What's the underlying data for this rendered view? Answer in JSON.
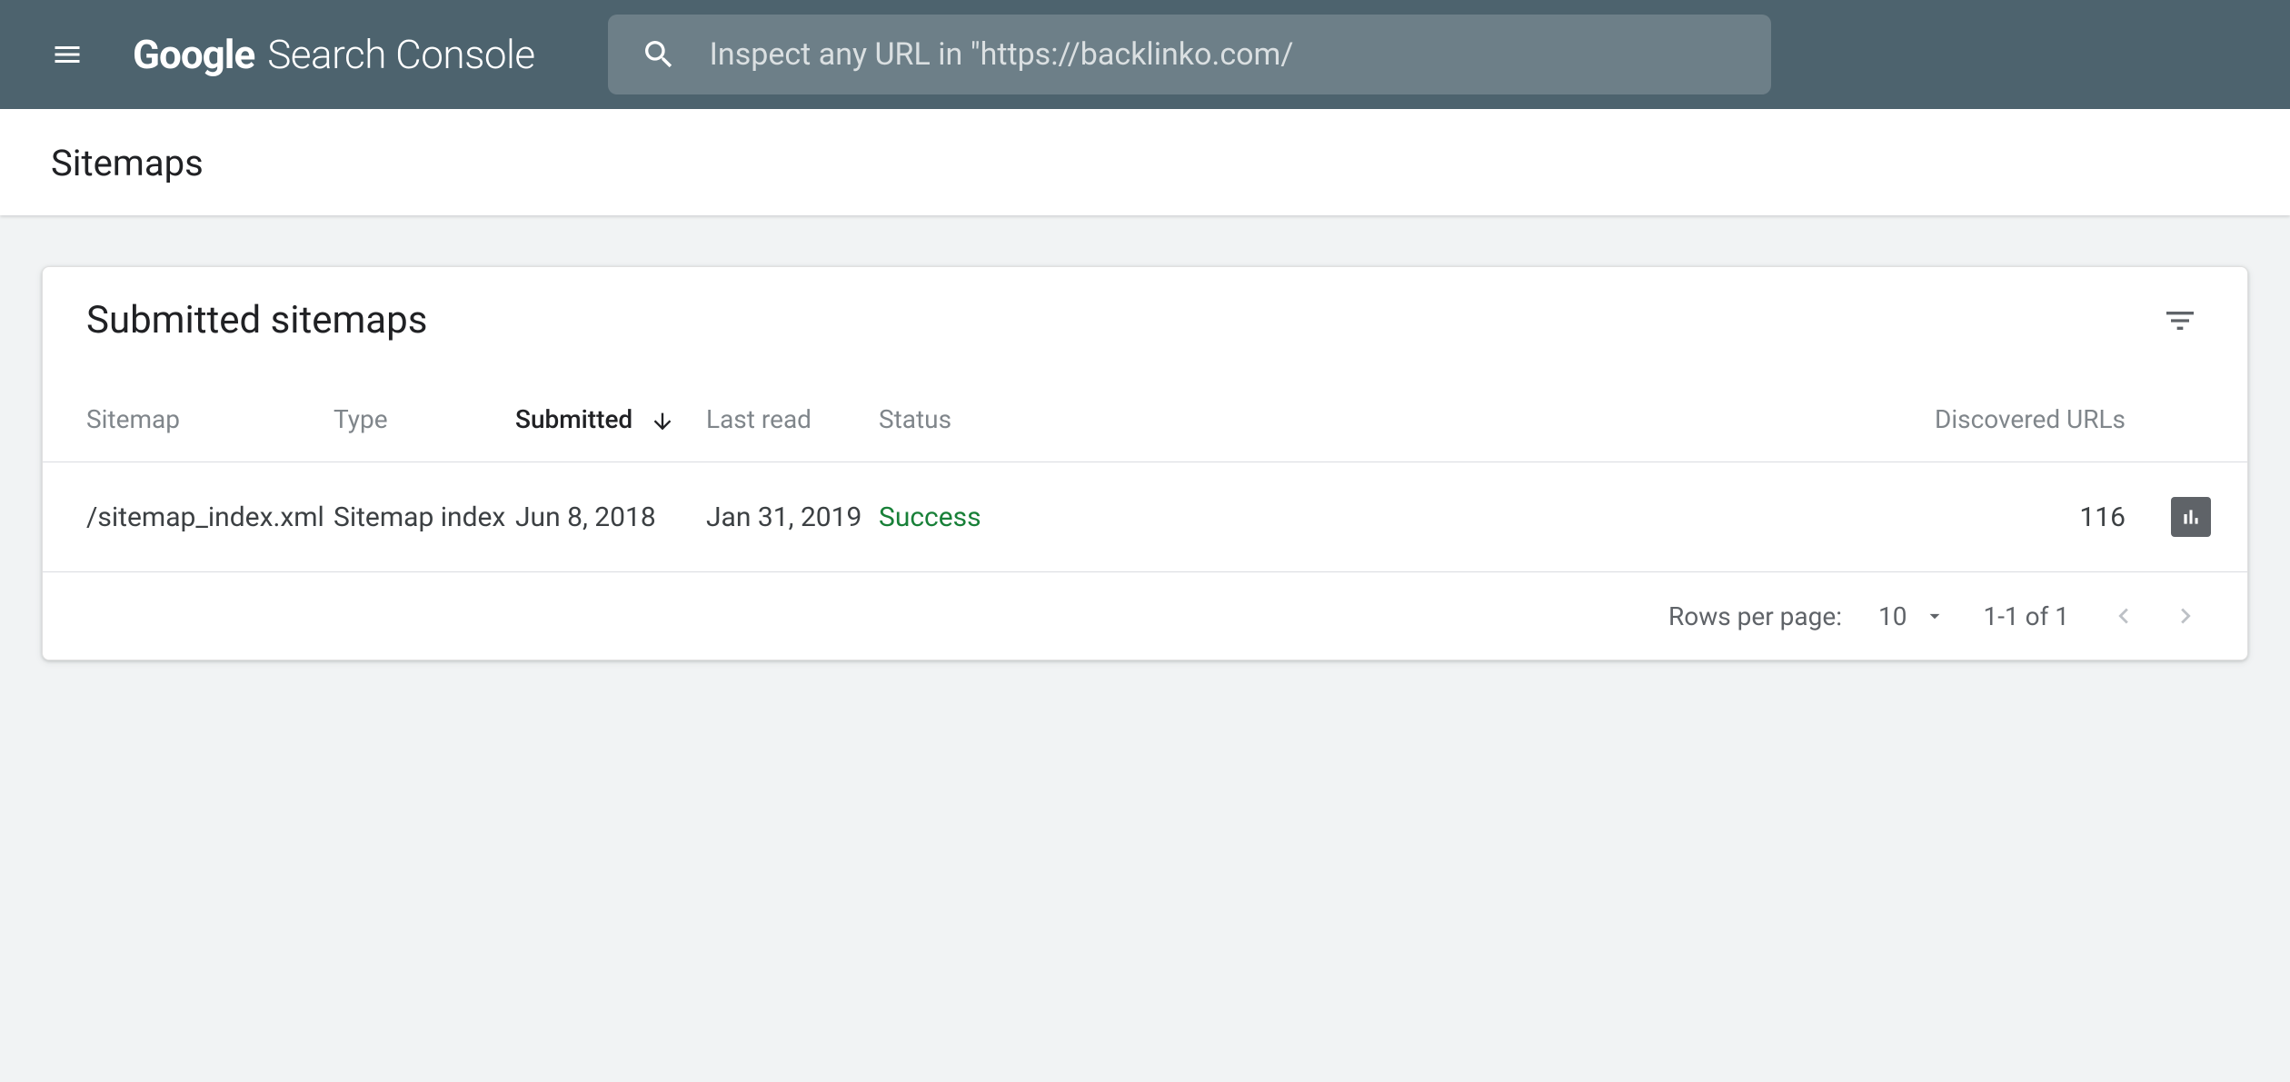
{
  "header": {
    "logo_google": "Google",
    "logo_product": "Search Console",
    "search_placeholder": "Inspect any URL in \"https://backlinko.com/"
  },
  "page": {
    "title": "Sitemaps"
  },
  "card": {
    "title": "Submitted sitemaps",
    "columns": {
      "sitemap": "Sitemap",
      "type": "Type",
      "submitted": "Submitted",
      "last_read": "Last read",
      "status": "Status",
      "discovered": "Discovered URLs"
    },
    "rows": [
      {
        "sitemap": "/sitemap_index.xml",
        "type": "Sitemap index",
        "submitted": "Jun 8, 2018",
        "last_read": "Jan 31, 2019",
        "status": "Success",
        "discovered": "116"
      }
    ]
  },
  "pagination": {
    "rows_label": "Rows per page:",
    "rows_value": "10",
    "range": "1-1 of 1"
  }
}
